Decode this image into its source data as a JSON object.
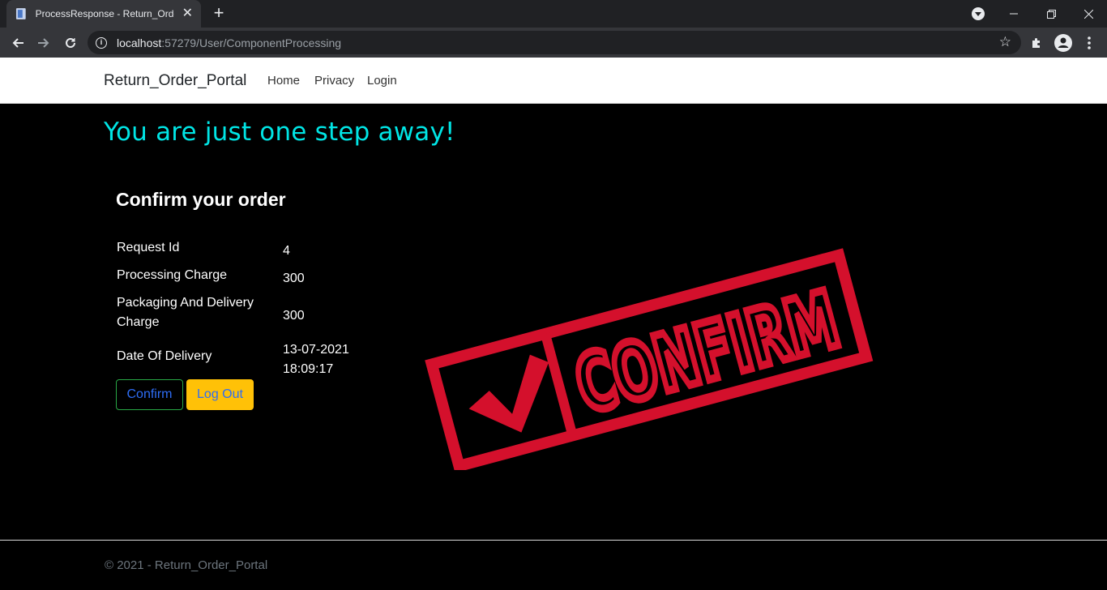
{
  "browser": {
    "tab_title": "ProcessResponse - Return_Order",
    "url_host": "localhost",
    "url_path": ":57279/User/ComponentProcessing"
  },
  "site": {
    "brand": "Return_Order_Portal",
    "nav": [
      "Home",
      "Privacy",
      "Login"
    ]
  },
  "main": {
    "hero": "You are just one step away!",
    "card_title": "Confirm your order",
    "rows": [
      {
        "label": "Request Id",
        "value": "4"
      },
      {
        "label": "Processing Charge",
        "value": "300"
      },
      {
        "label_line1": "Packaging And Delivery",
        "label_line2": "Charge",
        "value": "300"
      },
      {
        "label": "Date Of Delivery",
        "value_line1": "13-07-2021",
        "value_line2": "18:09:17"
      }
    ],
    "confirm_label": "Confirm",
    "logout_label": "Log Out",
    "stamp_text": "CONFIRM",
    "stamp_color": "#d4102c",
    "hero_color": "#00e5e5"
  },
  "footer": {
    "text": "© 2021 - Return_Order_Portal"
  }
}
